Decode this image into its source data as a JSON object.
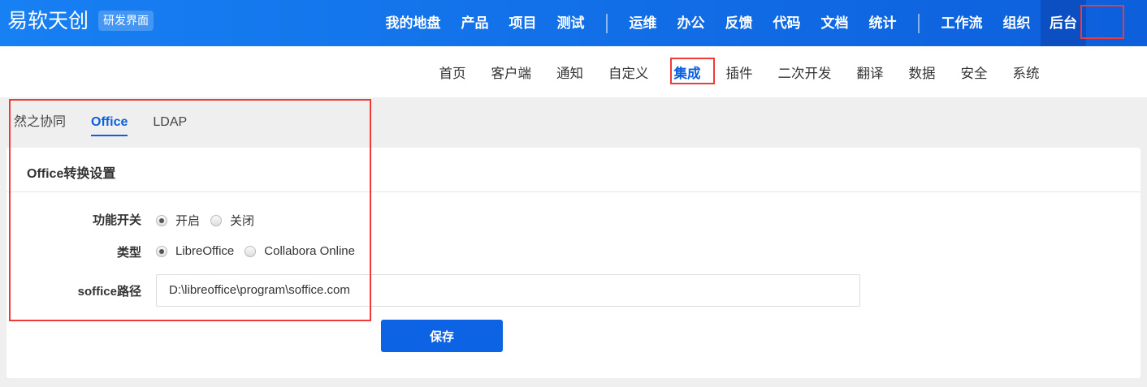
{
  "header": {
    "brand": "易软天创",
    "badge": "研发界面",
    "nav_group1": [
      "我的地盘",
      "产品",
      "项目",
      "测试"
    ],
    "nav_group2": [
      "运维",
      "办公",
      "反馈",
      "代码",
      "文档",
      "统计"
    ],
    "nav_group3": [
      "工作流",
      "组织",
      "后台"
    ]
  },
  "subnav": [
    "首页",
    "客户端",
    "通知",
    "自定义",
    "集成",
    "插件",
    "二次开发",
    "翻译",
    "数据",
    "安全",
    "系统"
  ],
  "tabs": [
    "然之协同",
    "Office",
    "LDAP"
  ],
  "card": {
    "title": "Office转换设置",
    "switch_label": "功能开关",
    "switch_options": [
      "开启",
      "关闭"
    ],
    "type_label": "类型",
    "type_options": [
      "LibreOffice",
      "Collabora Online"
    ],
    "path_label": "soffice路径",
    "path_value": "D:\\libreoffice\\program\\soffice.com",
    "save": "保存"
  },
  "colors": {
    "accent": "#0c5fe0",
    "highlight": "#f03a3a"
  }
}
